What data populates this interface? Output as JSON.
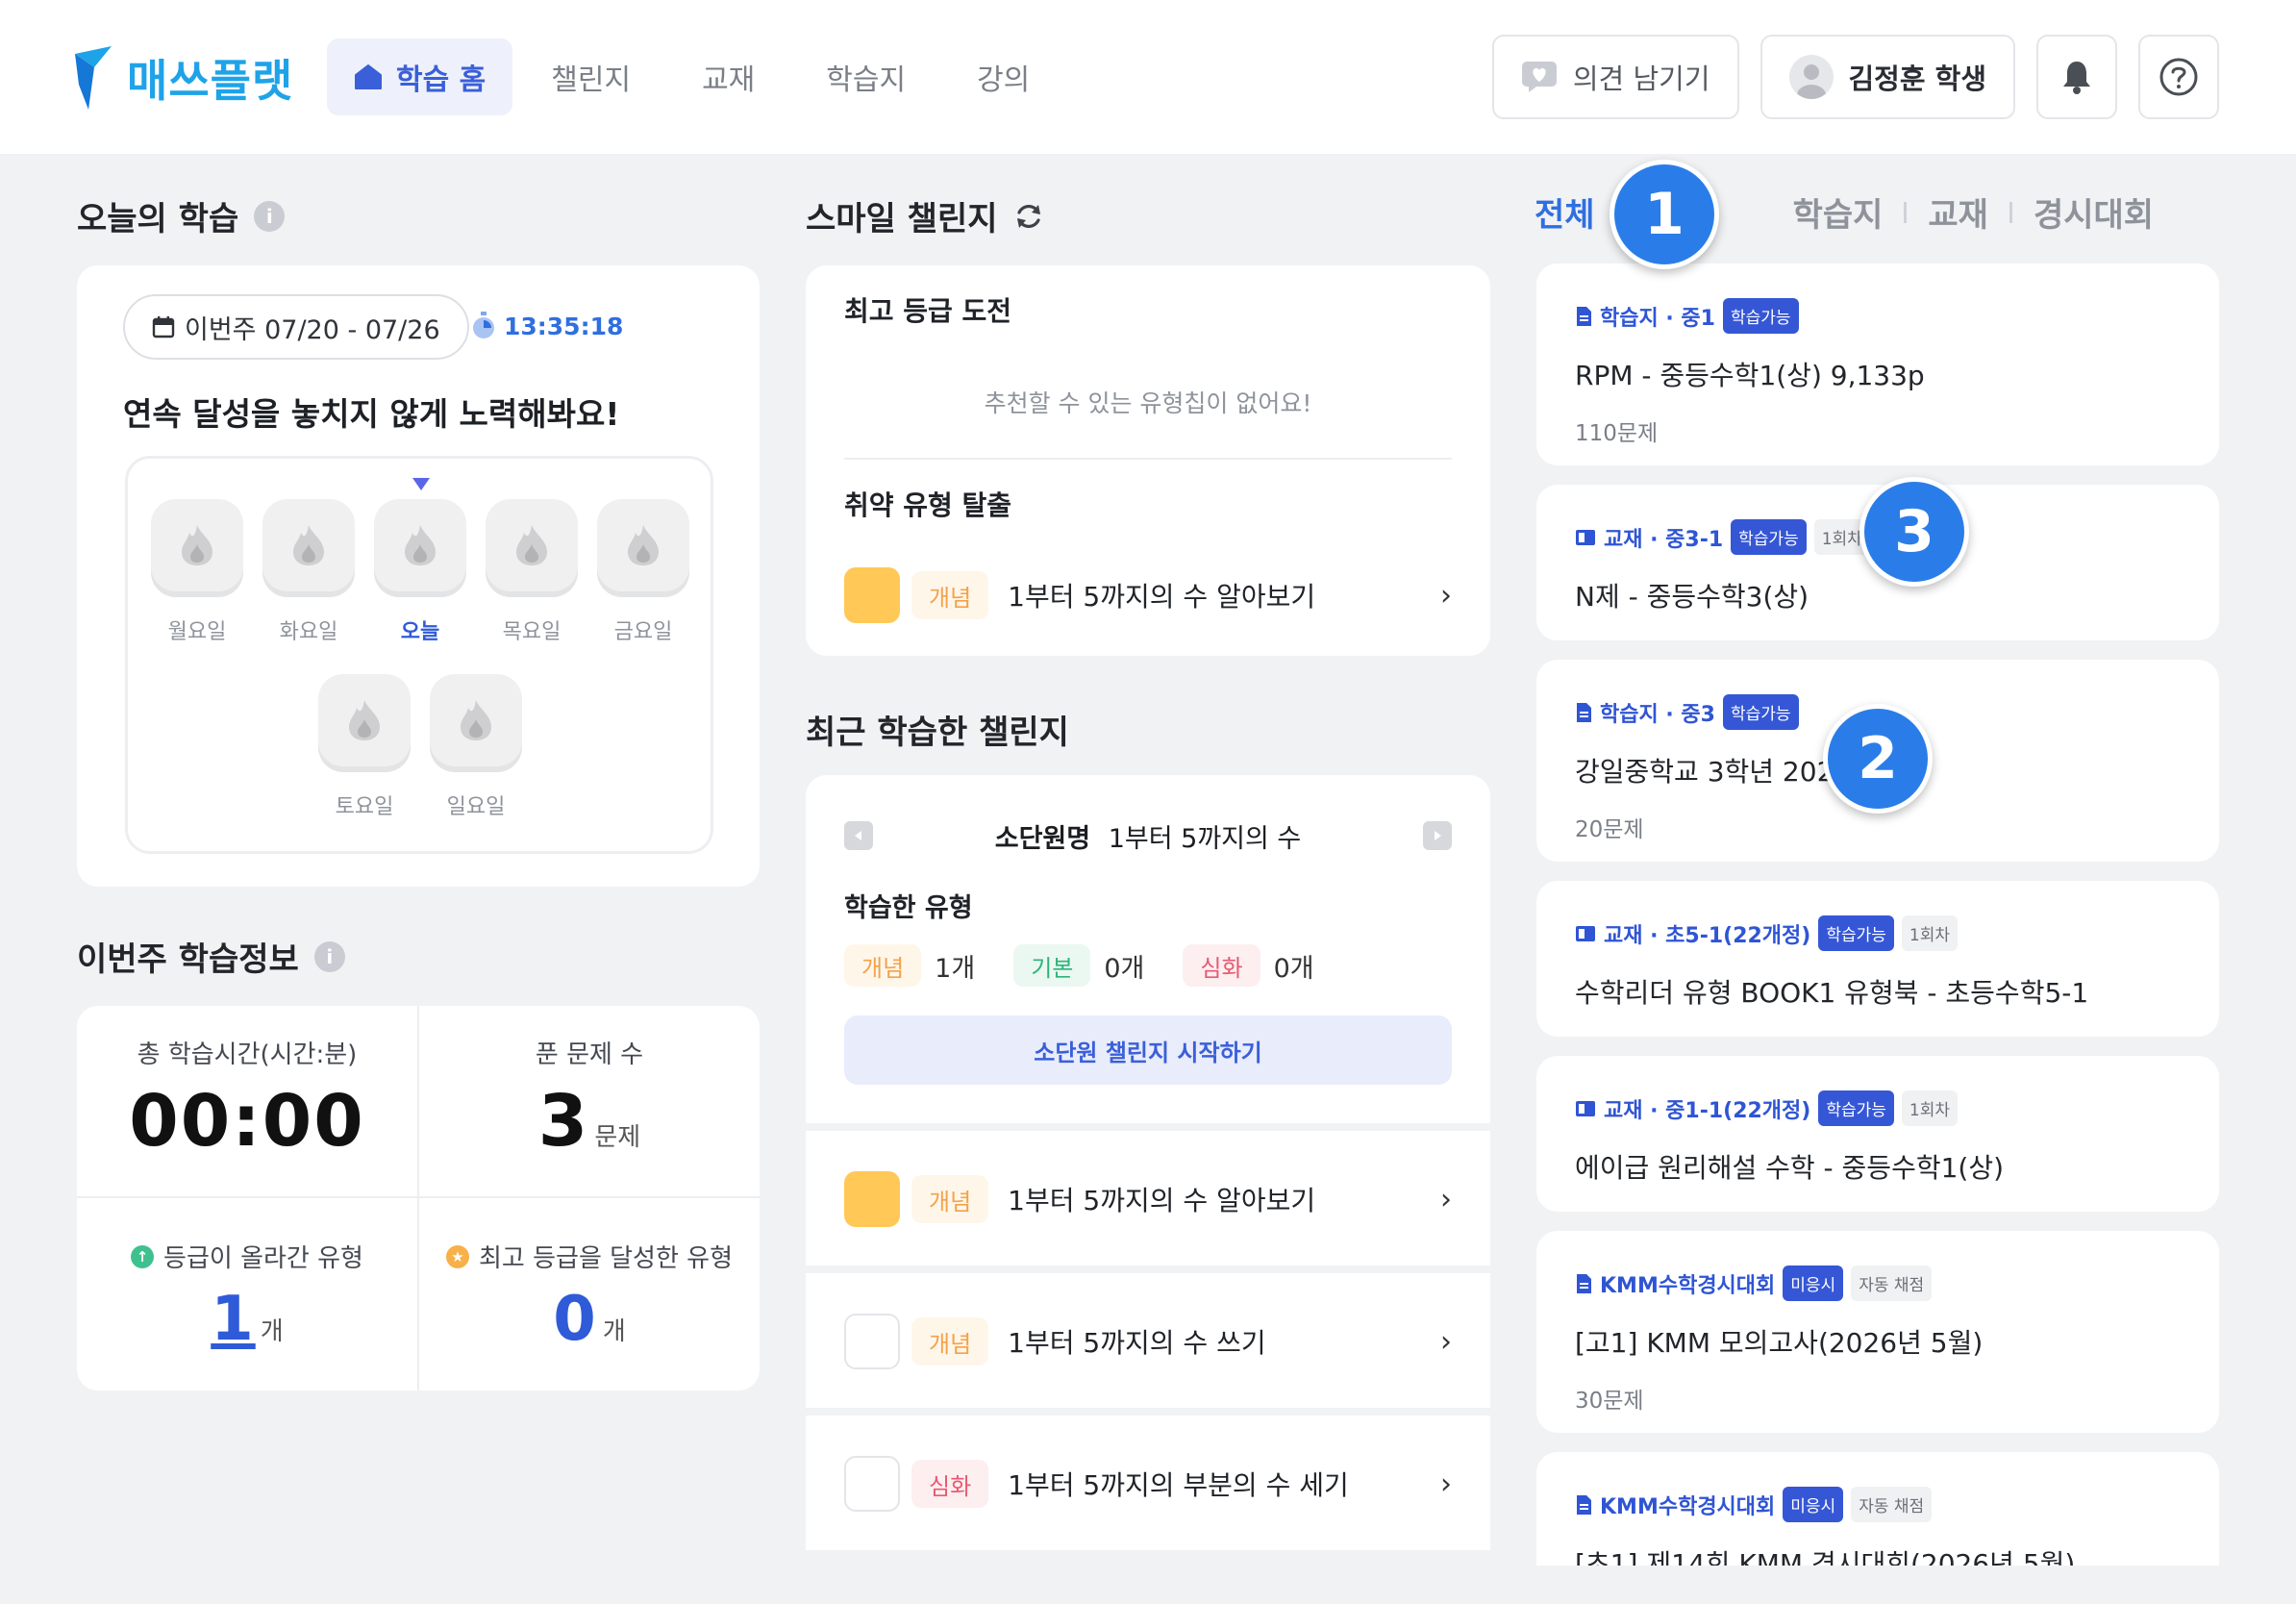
{
  "header": {
    "logo_text": "매쓰플랫",
    "nav": [
      {
        "label": "학습 홈",
        "active": true
      },
      {
        "label": "챌린지"
      },
      {
        "label": "교재"
      },
      {
        "label": "학습지"
      },
      {
        "label": "강의"
      }
    ],
    "feedback_label": "의견 남기기",
    "user_label": "김정훈 학생",
    "icons": [
      "bell-icon",
      "help-icon"
    ]
  },
  "today": {
    "title": "오늘의 학습",
    "date_range": "이번주 07/20 - 07/26",
    "timer": "13:35:18",
    "message": "연속 달성을 놓치지 않게 노력해봐요!",
    "days": [
      "월요일",
      "화요일",
      "오늘",
      "목요일",
      "금요일",
      "토요일",
      "일요일"
    ]
  },
  "weekly": {
    "title": "이번주 학습정보",
    "total_time_label": "총 학습시간(시간:분)",
    "total_time": "00:00",
    "solved_label": "푼 문제 수",
    "solved": "3",
    "solved_unit": "문제",
    "up_label": "등급이 올라간 유형",
    "up_value": "1",
    "up_unit": "개",
    "top_label": "최고 등급을 달성한 유형",
    "top_value": "0",
    "top_unit": "개"
  },
  "smile": {
    "title": "스마일 챌린지",
    "best_label": "최고 등급 도전",
    "empty_msg": "추천할 수 있는 유형칩이 없어요!",
    "weak_label": "취약 유형 탈출",
    "weak_item": {
      "tag": "개념",
      "text": "1부터 5까지의 수 알아보기"
    }
  },
  "recent": {
    "title": "최근 학습한 챌린지",
    "unit_prefix": "소단원명",
    "unit_name": "1부터 5까지의 수",
    "studied_label": "학습한 유형",
    "counts": [
      {
        "tag": "개념",
        "value": "1개"
      },
      {
        "tag": "기본",
        "value": "0개"
      },
      {
        "tag": "심화",
        "value": "0개"
      }
    ],
    "start_label": "소단원 챌린지 시작하기",
    "items": [
      {
        "tag": "개념",
        "text": "1부터 5까지의 수 알아보기"
      },
      {
        "tag": "개념",
        "text": "1부터 5까지의 수 쓰기"
      },
      {
        "tag": "심화",
        "text": "1부터 5까지의 부분의 수 세기"
      }
    ]
  },
  "filter": {
    "tabs": [
      "전체",
      "학습지",
      "교재",
      "경시대회"
    ]
  },
  "assignments": [
    {
      "kind": "학습지 · 중1",
      "badge": "학습가능",
      "extra": "",
      "title": "RPM - 중등수학1(상) 9,133p",
      "sub": "110문제"
    },
    {
      "kind": "교재 · 중3-1",
      "badge": "학습가능",
      "extra": "1회차",
      "title": "N제 - 중등수학3(상)",
      "sub": ""
    },
    {
      "kind": "학습지 · 중3",
      "badge": "학습가능",
      "extra": "",
      "title": "강일중학교 3학년 2024 중간",
      "sub": "20문제"
    },
    {
      "kind": "교재 · 초5-1(22개정)",
      "badge": "학습가능",
      "extra": "1회차",
      "title": "수학리더 유형 BOOK1 유형북 - 초등수학5-1",
      "sub": ""
    },
    {
      "kind": "교재 · 중1-1(22개정)",
      "badge": "학습가능",
      "extra": "1회차",
      "title": "에이급 원리해설 수학 - 중등수학1(상)",
      "sub": ""
    },
    {
      "kind": "KMM수학경시대회",
      "badge": "미응시",
      "extra": "자동 채점",
      "title": "[고1] KMM 모의고사(2026년 5월)",
      "sub": "30문제"
    },
    {
      "kind": "KMM수학경시대회",
      "badge": "미응시",
      "extra": "자동 채점",
      "title": "[초1] 제14회 KMM 경시대회(2026년 5월)",
      "sub": ""
    }
  ],
  "markers": [
    "1",
    "2",
    "3"
  ],
  "colors": {
    "accent": "#2f6fe0",
    "brand": "#1fa3e8",
    "marker": "#2a7de8",
    "swatch": "#ffc857"
  }
}
